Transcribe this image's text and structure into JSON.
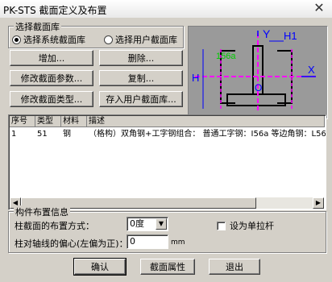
{
  "window": {
    "title": "PK-STS 截面定义及布置",
    "close_glyph": "✕"
  },
  "library": {
    "title": "选择截面库",
    "option_system": "选择系统截面库",
    "option_user": "选择用户截面库",
    "selected": "system"
  },
  "buttons": {
    "add": "增加...",
    "delete": "删除...",
    "modify_params": "修改截面参数...",
    "copy": "复制...",
    "modify_type": "修改截面类型...",
    "save_user": "存入用户截面库..."
  },
  "preview": {
    "label_y": "Y",
    "label_h1": "H1",
    "label_h": "H",
    "label_o": "O",
    "label_x": "X",
    "label_size": "156a",
    "colors": {
      "bg": "#9a9a9a",
      "outline": "#000000",
      "center": "#ff00ff",
      "label": "#0000ff",
      "size": "#00cc00"
    }
  },
  "table": {
    "columns": [
      "序号",
      "类型",
      "材料",
      "描述"
    ],
    "rows": [
      {
        "index": "1",
        "type": "51",
        "material": "钢",
        "description": "（格构）双角钢+工字钢组合： 普通工字钢：I56a 等边角钢：L56"
      }
    ]
  },
  "layout_info": {
    "title": "构件布置信息",
    "rotation_label": "柱截面的布置方式：",
    "rotation_value": "0度",
    "single_tension_label": "设为单拉杆",
    "offset_label": "柱对轴线的偏心(左偏为正)：",
    "offset_value": "0",
    "offset_unit": "mm"
  },
  "footer": {
    "confirm": "确认",
    "section_props": "截面属性",
    "exit": "退出"
  }
}
